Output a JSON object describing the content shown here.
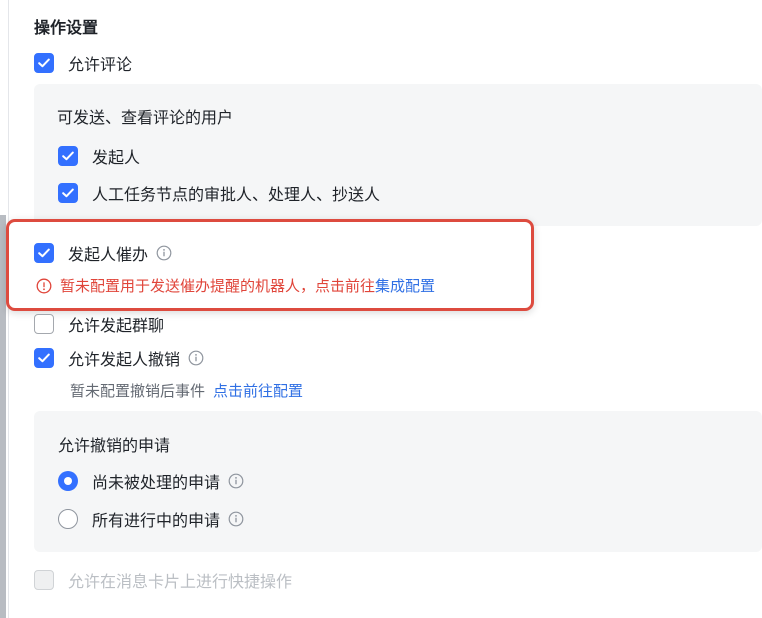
{
  "section": {
    "title": "操作设置"
  },
  "allow_comment": {
    "label": "允许评论",
    "checked": true
  },
  "comment_users": {
    "title": "可发送、查看评论的用户",
    "items": [
      {
        "label": "发起人",
        "checked": true
      },
      {
        "label": "人工任务节点的审批人、处理人、抄送人",
        "checked": true
      }
    ]
  },
  "urge": {
    "label": "发起人催办",
    "checked": true,
    "info_icon": "info-circle-icon",
    "warning_text": "暂未配置用于发送催办提醒的机器人，点击前往",
    "warning_link": "集成配置",
    "warning_icon": "alert-circle-icon",
    "warning_color": "#e0453a",
    "highlight_color": "#dd4b3f"
  },
  "group_chat": {
    "label": "允许发起群聊",
    "checked": false
  },
  "revoke": {
    "label": "允许发起人撤销",
    "checked": true,
    "info_icon": "info-circle-icon",
    "hint_text": "暂未配置撤销后事件",
    "hint_link": "点击前往配置"
  },
  "revoke_requests": {
    "title": "允许撤销的申请",
    "options": [
      {
        "label": "尚未被处理的申请",
        "selected": true
      },
      {
        "label": "所有进行中的申请",
        "selected": false
      }
    ]
  },
  "quick_action": {
    "label": "允许在消息卡片上进行快捷操作",
    "checked": false,
    "disabled": true
  },
  "colors": {
    "accent": "#3370ff",
    "link": "#2f6fe4",
    "panel_bg": "#f5f6f7"
  }
}
